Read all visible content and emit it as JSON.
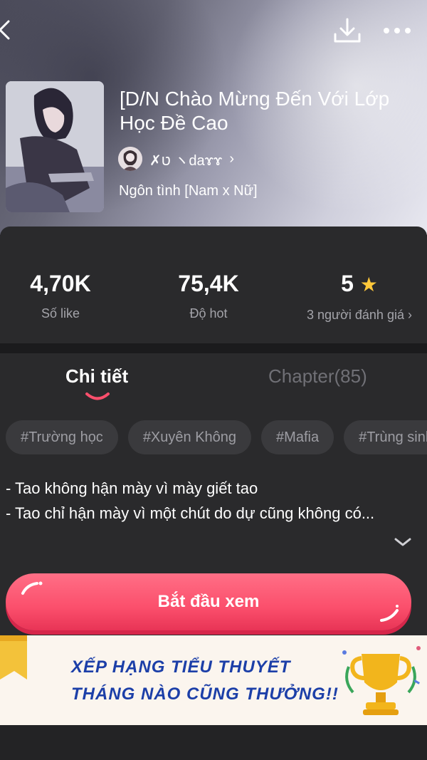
{
  "header": {
    "back_icon": "chevron-left-icon",
    "download_icon": "download-icon",
    "more_icon": "more-dots-icon"
  },
  "story": {
    "title": "[D/N Chào Mừng Đến Với Lớp Học Đề Cao",
    "author": "✗ט ヽdaɤɤ",
    "genre": "Ngôn tình [Nam x Nữ]"
  },
  "stats": {
    "likes_value": "4,70K",
    "likes_label": "Số like",
    "hot_value": "75,4K",
    "hot_label": "Độ hot",
    "rating_value": "5",
    "rating_label": "3 người đánh giá ›"
  },
  "tabs": {
    "details": "Chi tiết",
    "chapters": "Chapter(85)"
  },
  "tags": [
    "#Trường học",
    "#Xuyên Không",
    "#Mafia",
    "#Trùng sinh"
  ],
  "description": "- Tao không hận mày vì mày giết tao\n- Tao chỉ hận mày vì một chút do dự cũng không có...",
  "start_button": "Bắt đầu xem",
  "banner": {
    "line1": "XẾP HẠNG TIỂU THUYẾT",
    "line2": "THÁNG NÀO CŨNG THƯỞNG!!"
  },
  "colors": {
    "accent": "#fb4f6c",
    "star": "#ffc83a",
    "banner_text": "#1c3fa8"
  }
}
